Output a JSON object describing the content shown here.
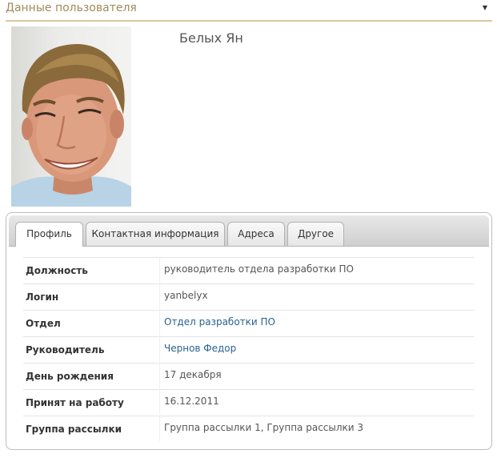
{
  "header": {
    "title": "Данные пользователя",
    "caret_icon": "chevron-down-icon"
  },
  "user": {
    "name": "Белых Ян"
  },
  "tabs": [
    {
      "label": "Профиль",
      "active": true
    },
    {
      "label": "Контактная информация",
      "active": false
    },
    {
      "label": "Адреса",
      "active": false
    },
    {
      "label": "Другое",
      "active": false
    }
  ],
  "profile": [
    {
      "label": "Должность",
      "value": "руководитель отдела разработки ПО"
    },
    {
      "label": "Логин",
      "value": "yanbelyx"
    },
    {
      "label": "Отдел",
      "value": "Отдел разработки ПО"
    },
    {
      "label": "Руководитель",
      "value": "Чернов Федор"
    },
    {
      "label": "День рождения",
      "value": "17 декабря"
    },
    {
      "label": "Принят на работу",
      "value": "16.12.2011"
    },
    {
      "label": "Группа рассылки",
      "value": "Группа рассылки 1, Группа рассылки 3"
    }
  ],
  "colors": {
    "accent": "#a08a5a",
    "link": "#2a6190",
    "rule": "#d9c7a0"
  }
}
